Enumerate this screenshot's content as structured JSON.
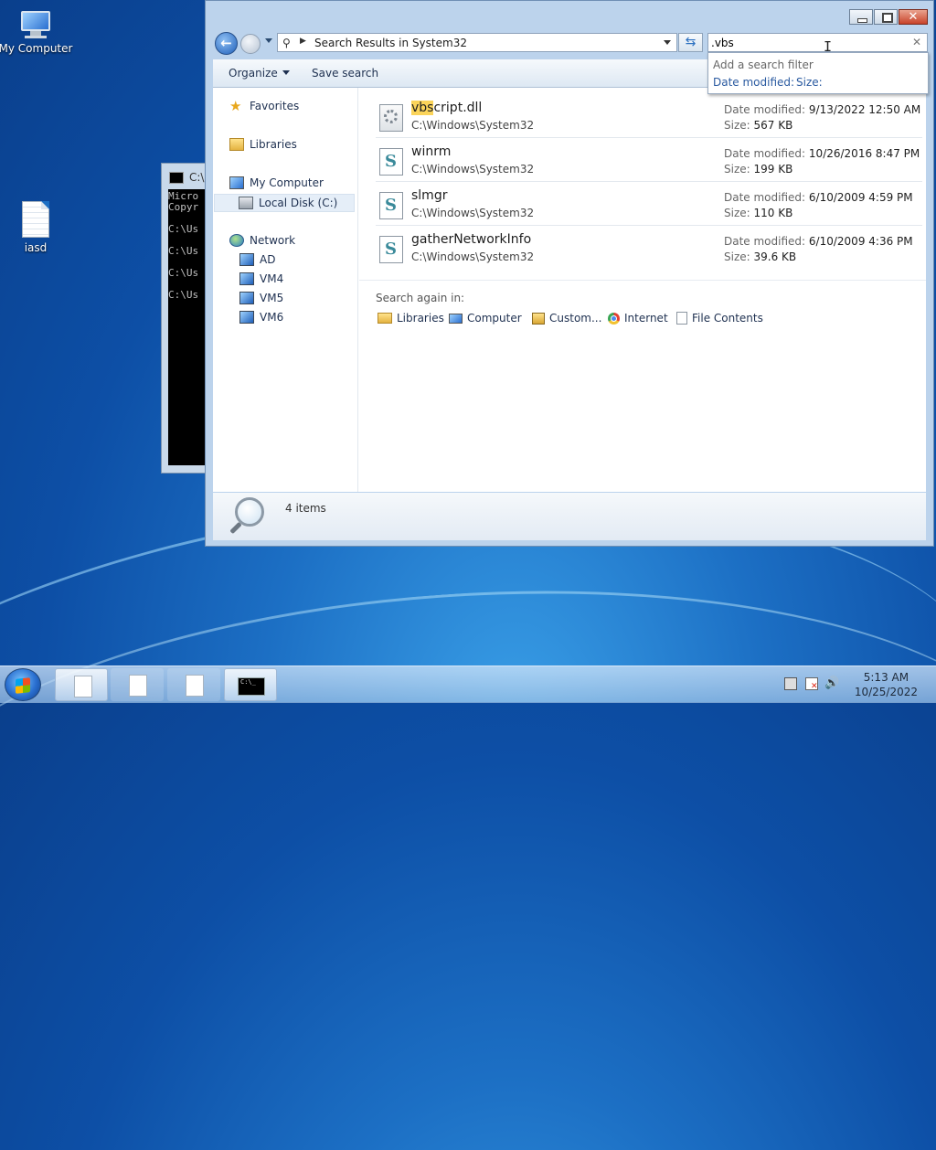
{
  "desktop": {
    "icons": [
      {
        "label": "My Computer"
      },
      {
        "label": "iasd"
      }
    ]
  },
  "console": {
    "title": "C:\\",
    "lines": [
      "Micro",
      "Copyr",
      "",
      "C:\\Us",
      "",
      "C:\\Us",
      "",
      "C:\\Us",
      "",
      "C:\\Us"
    ]
  },
  "explorer": {
    "address": "Search Results in System32",
    "search_value": ".vbs",
    "search_suggestions": {
      "header": "Add a search filter",
      "options": [
        "Date modified:",
        "Size:"
      ]
    },
    "toolbar": {
      "organize": "Organize",
      "save_search": "Save search"
    },
    "nav": {
      "favorites": "Favorites",
      "libraries": "Libraries",
      "my_computer": "My Computer",
      "local_disk": "Local Disk (C:)",
      "network": "Network",
      "servers": [
        "AD",
        "VM4",
        "VM5",
        "VM6"
      ]
    },
    "results": [
      {
        "name_highlight": "vbs",
        "name_rest": "cript.dll",
        "path": "C:\\Windows\\System32",
        "date_label": "Date modified:",
        "date": "9/13/2022 12:50 AM",
        "size_label": "Size:",
        "size": "567 KB",
        "icon": "dll-gear-icon"
      },
      {
        "name_highlight": "",
        "name_rest": "winrm",
        "path": "C:\\Windows\\System32",
        "date_label": "Date modified:",
        "date": "10/26/2016 8:47 PM",
        "size_label": "Size:",
        "size": "199 KB",
        "icon": "script-icon"
      },
      {
        "name_highlight": "",
        "name_rest": "slmgr",
        "path": "C:\\Windows\\System32",
        "date_label": "Date modified:",
        "date": "6/10/2009 4:59 PM",
        "size_label": "Size:",
        "size": "110 KB",
        "icon": "script-icon"
      },
      {
        "name_highlight": "",
        "name_rest": "gatherNetworkInfo",
        "path": "C:\\Windows\\System32",
        "date_label": "Date modified:",
        "date": "6/10/2009 4:36 PM",
        "size_label": "Size:",
        "size": "39.6 KB",
        "icon": "script-icon"
      }
    ],
    "search_again": {
      "label": "Search again in:",
      "locations": [
        "Libraries",
        "Computer",
        "Custom...",
        "Internet",
        "File Contents"
      ]
    },
    "details": {
      "count": "4 items"
    }
  },
  "taskbar": {
    "console_thumb": "C:\\_",
    "clock_time": "5:13 AM",
    "clock_date": "10/25/2022"
  }
}
